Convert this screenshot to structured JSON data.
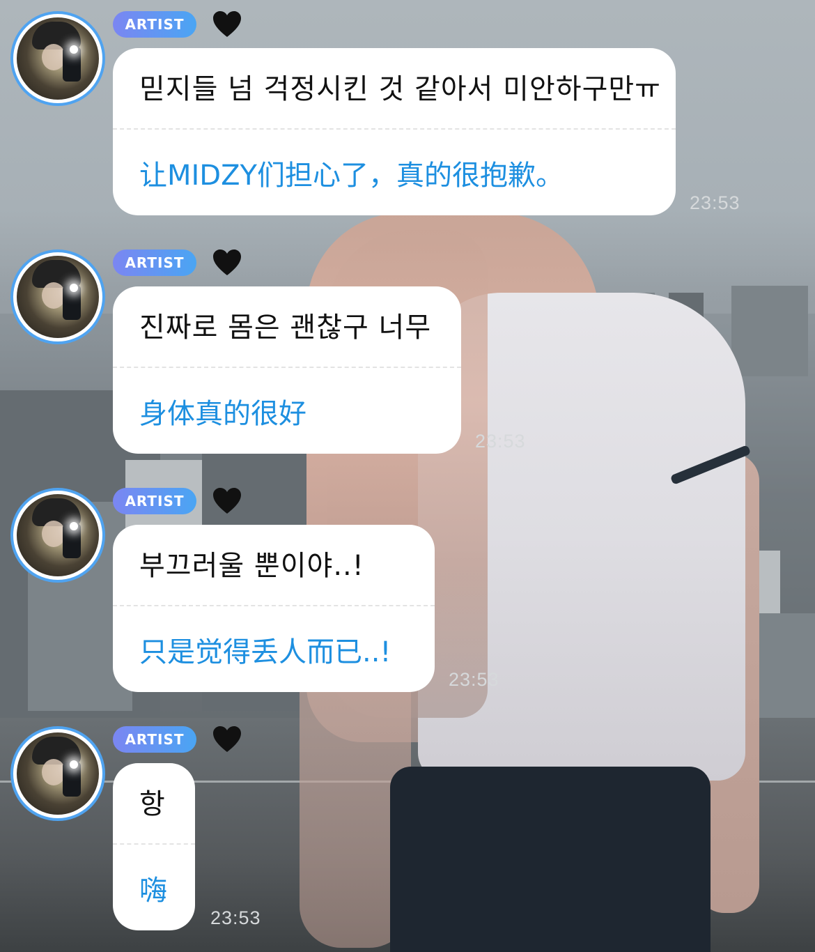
{
  "badge_label": "ARTIST",
  "colors": {
    "accent_blue": "#1d8fe0",
    "badge_start": "#7b86f2",
    "badge_end": "#4aa5f3",
    "avatar_ring": "#4fa3f0"
  },
  "messages": [
    {
      "original": "믿지들 넘 걱정시킨 것 같아서 미안하구만ㅠ",
      "translation": "让MIDZY们担心了，真的很抱歉。",
      "time": "23:53"
    },
    {
      "original": "진짜로 몸은 괜찮구 너무",
      "translation": "身体真的很好",
      "time": "23:53"
    },
    {
      "original": "부끄러울 뿐이야..!",
      "translation": "只是觉得丢人而已..!",
      "time": "23:53"
    },
    {
      "original": "항",
      "translation": "嗨",
      "time": "23:53"
    }
  ]
}
